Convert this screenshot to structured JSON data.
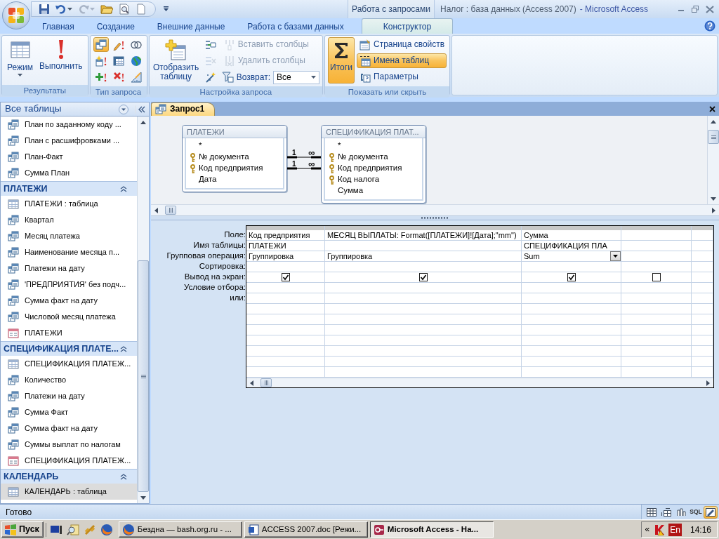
{
  "window": {
    "context_tab": "Работа с запросами",
    "document": "Налог : база данных (Access 2007)",
    "app": "- Microsoft Access"
  },
  "ribbon_tabs": [
    {
      "label": "Главная",
      "selected": false
    },
    {
      "label": "Создание",
      "selected": false
    },
    {
      "label": "Внешние данные",
      "selected": false
    },
    {
      "label": "Работа с базами данных",
      "selected": false
    },
    {
      "label": "Конструктор",
      "selected": true
    }
  ],
  "ribbon_groups": [
    {
      "title": "Результаты",
      "items": [
        {
          "kind": "large",
          "label": "Режим",
          "dropdown": true
        },
        {
          "kind": "large",
          "label": "Выполнить"
        }
      ]
    },
    {
      "title": "Тип запроса",
      "items": [
        {
          "kind": "icon",
          "selected": true
        },
        {
          "kind": "icon",
          "selected": false
        },
        {
          "kind": "icon",
          "selected": false
        },
        {
          "kind": "icon",
          "selected": false
        },
        {
          "kind": "icon",
          "selected": false
        },
        {
          "kind": "icon",
          "selected": false
        },
        {
          "kind": "icon",
          "selected": false
        },
        {
          "kind": "icon",
          "selected": false
        },
        {
          "kind": "icon",
          "selected": false
        }
      ]
    },
    {
      "title": "Настройка запроса",
      "items": [
        {
          "kind": "large",
          "label": "Отобразить таблицу"
        },
        {
          "kind": "small",
          "disabled": false
        },
        {
          "kind": "small",
          "disabled": true
        },
        {
          "kind": "small",
          "disabled": false
        },
        {
          "kind": "small",
          "label": "Вставить столбцы",
          "disabled": true
        },
        {
          "kind": "small",
          "label": "Удалить столбцы",
          "disabled": true
        },
        {
          "kind": "select",
          "label": "Возврат:",
          "value": "Все"
        }
      ]
    },
    {
      "title": "Показать или скрыть",
      "items": [
        {
          "kind": "large",
          "label": "Итоги",
          "selected": true
        },
        {
          "kind": "small",
          "label": "Страница свойств",
          "selected": false
        },
        {
          "kind": "small",
          "label": "Имена таблиц",
          "selected": true
        },
        {
          "kind": "small",
          "label": "Параметры",
          "selected": false
        }
      ]
    }
  ],
  "nav": {
    "title": "Все таблицы",
    "groups": [
      {
        "items": [
          {
            "label": "План по заданному коду ...",
            "kind": "query",
            "selected": false
          },
          {
            "label": "План с расшифровками ...",
            "kind": "query",
            "selected": false
          },
          {
            "label": "План-Факт",
            "kind": "query",
            "selected": false
          },
          {
            "label": "Сумма План",
            "kind": "query",
            "selected": false
          }
        ]
      },
      {
        "title": "ПЛАТЕЖИ",
        "items": [
          {
            "label": "ПЛАТЕЖИ : таблица",
            "kind": "table",
            "selected": false
          },
          {
            "label": "Квартал",
            "kind": "query",
            "selected": false
          },
          {
            "label": "Месяц платежа",
            "kind": "query",
            "selected": false
          },
          {
            "label": "Наименование месяца п...",
            "kind": "query",
            "selected": false
          },
          {
            "label": "Платежи на дату",
            "kind": "query",
            "selected": false
          },
          {
            "label": "'ПРЕДПРИЯТИЯ' без подч...",
            "kind": "query",
            "selected": false
          },
          {
            "label": "Сумма факт на дату",
            "kind": "query",
            "selected": false
          },
          {
            "label": "Числовой месяц платежа",
            "kind": "query",
            "selected": false
          },
          {
            "label": "ПЛАТЕЖИ",
            "kind": "form",
            "selected": false
          }
        ]
      },
      {
        "title": "СПЕЦИФИКАЦИЯ ПЛАТЕ...",
        "items": [
          {
            "label": "СПЕЦИФИКАЦИЯ ПЛАТЕЖ...",
            "kind": "table",
            "selected": false
          },
          {
            "label": "Количество",
            "kind": "query",
            "selected": false
          },
          {
            "label": "Платежи на дату",
            "kind": "query",
            "selected": false
          },
          {
            "label": "Сумма Факт",
            "kind": "query",
            "selected": false
          },
          {
            "label": "Сумма факт на дату",
            "kind": "query",
            "selected": false
          },
          {
            "label": "Суммы выплат по налогам",
            "kind": "query",
            "selected": false
          },
          {
            "label": "СПЕЦИФИКАЦИЯ ПЛАТЕЖ...",
            "kind": "form",
            "selected": false
          }
        ]
      },
      {
        "title": "КАЛЕНДАРЬ",
        "items": [
          {
            "label": "КАЛЕНДАРЬ : таблица",
            "kind": "table",
            "selected": true
          }
        ]
      }
    ]
  },
  "document_tab": {
    "label": "Запрос1"
  },
  "diagram": {
    "tables": [
      {
        "title": "ПЛАТЕЖИ",
        "fields": [
          {
            "name": "*",
            "key": false
          },
          {
            "name": "№ документа",
            "key": true
          },
          {
            "name": "Код предприятия",
            "key": true
          },
          {
            "name": "Дата",
            "key": false
          }
        ]
      },
      {
        "title": "СПЕЦИФИКАЦИЯ ПЛАТ...",
        "fields": [
          {
            "name": "*",
            "key": false
          },
          {
            "name": "№ документа",
            "key": true
          },
          {
            "name": "Код предприятия",
            "key": true
          },
          {
            "name": "Код налога",
            "key": true
          },
          {
            "name": "Сумма",
            "key": false
          }
        ]
      }
    ],
    "joins": [
      {
        "one": "1",
        "many": "∞"
      },
      {
        "one": "1",
        "many": "∞"
      }
    ]
  },
  "design_grid": {
    "row_labels": [
      "Поле:",
      "Имя таблицы:",
      "Групповая операция:",
      "Сортировка:",
      "Вывод на экран:",
      "Условие отбора:",
      "или:"
    ],
    "columns": [
      {
        "field": "Код предприятия",
        "table": "ПЛАТЕЖИ",
        "total": "Группировка",
        "show": true,
        "focused": false
      },
      {
        "field": "МЕСЯЦ ВЫПЛАТЫ: Format([ПЛАТЕЖИ]![Дата];\"mm\")",
        "total": "Группировка",
        "show": true,
        "focused": false
      },
      {
        "field": "Сумма",
        "table": "СПЕЦИФИКАЦИЯ ПЛА",
        "total": "Sum",
        "show": true,
        "focused": true
      },
      {
        "show": false,
        "focused": false
      }
    ]
  },
  "status": {
    "text": "Готово",
    "views": [
      {
        "kind": "datasheet",
        "selected": false
      },
      {
        "kind": "pivot_table",
        "selected": false
      },
      {
        "kind": "pivot_chart",
        "selected": false
      },
      {
        "kind": "sql",
        "label": "SQL",
        "selected": false
      },
      {
        "kind": "design",
        "selected": true
      }
    ]
  },
  "taskbar": {
    "start": "Пуск",
    "tasks": [
      {
        "label": "Бездна — bash.org.ru - ...",
        "kind": "browser",
        "selected": false
      },
      {
        "label": "ACCESS 2007.doc [Режи...",
        "kind": "word",
        "selected": false
      },
      {
        "label": "Microsoft Access - На...",
        "kind": "access",
        "selected": true
      }
    ],
    "chevron": "«",
    "language": "En",
    "time": "14:16"
  }
}
